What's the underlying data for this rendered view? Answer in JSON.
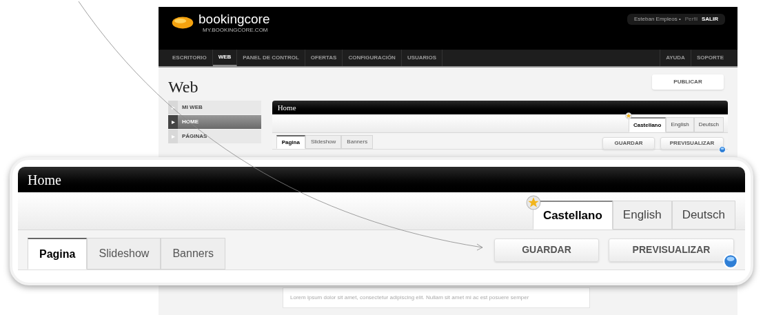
{
  "brand": {
    "name": "bookingcore",
    "url": "MY.BOOKINGCORE.COM"
  },
  "user_bar": {
    "user": "Esteban Empleos •",
    "profile_link": "Perfil",
    "logout": "SALIR"
  },
  "nav": [
    {
      "label": "ESCRITORIO",
      "selected": false
    },
    {
      "label": "WEB",
      "selected": true
    },
    {
      "label": "PANEL DE CONTROL",
      "selected": false
    },
    {
      "label": "OFERTAS",
      "selected": false
    },
    {
      "label": "CONFIGURACIÓN",
      "selected": false
    },
    {
      "label": "USUARIOS",
      "selected": false
    }
  ],
  "nav_right": [
    "AYUDA",
    "SOPORTE"
  ],
  "page_title": "Web",
  "publish_button": "PUBLICAR",
  "sidebar": [
    {
      "label": "MI WEB",
      "selected": false
    },
    {
      "label": "HOME",
      "selected": true
    },
    {
      "label": "PÁGINAS",
      "selected": false
    }
  ],
  "panel": {
    "title": "Home",
    "languages": [
      {
        "label": "Castellano",
        "selected": true,
        "default": true
      },
      {
        "label": "English",
        "selected": false,
        "default": false
      },
      {
        "label": "Deutsch",
        "selected": false,
        "default": false
      }
    ],
    "tabs": [
      {
        "label": "Pagina",
        "selected": true
      },
      {
        "label": "Slideshow",
        "selected": false
      },
      {
        "label": "Banners",
        "selected": false
      }
    ],
    "buttons": [
      {
        "label": "GUARDAR",
        "kind": "plain"
      },
      {
        "label": "PREVISUALIZAR",
        "kind": "preview"
      }
    ]
  },
  "zoom_panel": {
    "title": "Home",
    "languages": [
      {
        "label": "Castellano",
        "selected": true,
        "default": true
      },
      {
        "label": "English",
        "selected": false,
        "default": false
      },
      {
        "label": "Deutsch",
        "selected": false,
        "default": false
      }
    ],
    "tabs": [
      {
        "label": "Pagina",
        "selected": true
      },
      {
        "label": "Slideshow",
        "selected": false
      },
      {
        "label": "Banners",
        "selected": false
      }
    ],
    "buttons": [
      {
        "label": "GUARDAR",
        "kind": "plain"
      },
      {
        "label": "PREVISUALIZAR",
        "kind": "preview"
      }
    ]
  },
  "content_text": "Lorem ipsum dolor sit amet, consectetur adipiscing elit. Nullam sit amet mi ac est posuere semper"
}
